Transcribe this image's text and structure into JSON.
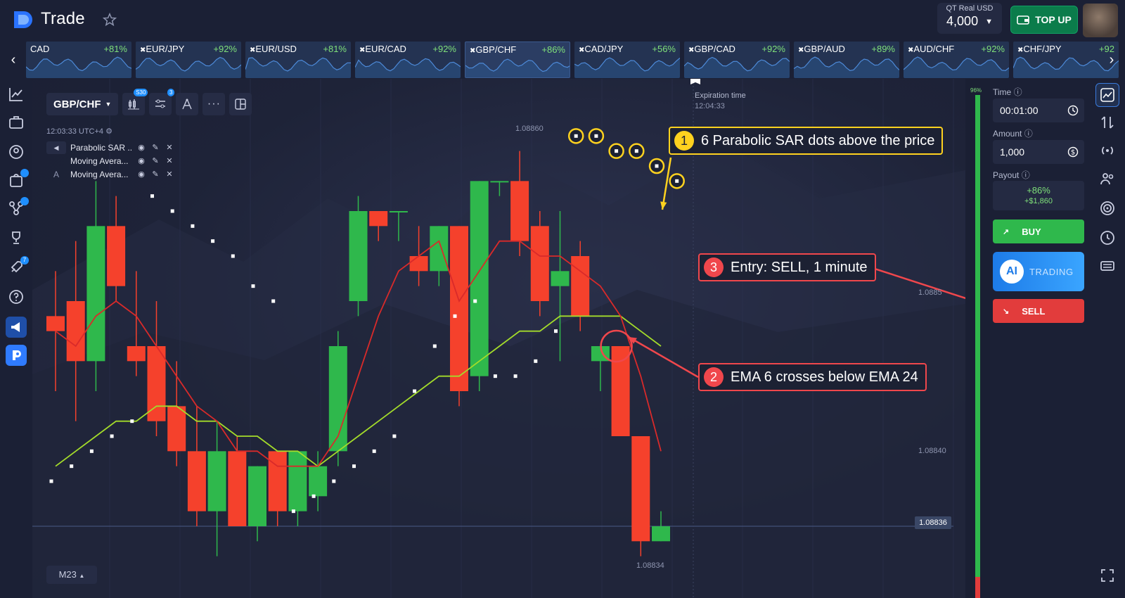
{
  "header": {
    "brand": "Trade",
    "account_label": "QT Real  USD",
    "balance": "4,000",
    "topup_label": "TOP UP"
  },
  "tickers": [
    {
      "name": "CAD",
      "payout": "+81%"
    },
    {
      "name": "EUR/JPY",
      "payout": "+92%"
    },
    {
      "name": "EUR/USD",
      "payout": "+81%"
    },
    {
      "name": "EUR/CAD",
      "payout": "+92%"
    },
    {
      "name": "GBP/CHF",
      "payout": "+86%",
      "active": true
    },
    {
      "name": "CAD/JPY",
      "payout": "+56%"
    },
    {
      "name": "GBP/CAD",
      "payout": "+92%"
    },
    {
      "name": "GBP/AUD",
      "payout": "+89%"
    },
    {
      "name": "AUD/CHF",
      "payout": "+92%"
    },
    {
      "name": "CHF/JPY",
      "payout": "+92"
    }
  ],
  "leftbar": {
    "badges": [
      "7"
    ]
  },
  "chart": {
    "pair": "GBP/CHF",
    "tool_badges": {
      "s30": "S30",
      "indicators": "3"
    },
    "timestamp": "12:03:33 UTC+4",
    "indicators": [
      {
        "name": "Parabolic SAR ..."
      },
      {
        "name": "Moving Avera..."
      },
      {
        "name": "Moving Avera..."
      }
    ],
    "expiration_label": "Expiration time",
    "expiration_time": "12:04:33",
    "price_high": "1.08860",
    "price_mid": "1.0885",
    "price_lower": "1.08840",
    "current_price": "1.08836",
    "price_low": "1.08834",
    "timeframe": "M23",
    "progress_pct": "96%",
    "progress_fraction": 0.96
  },
  "callouts": {
    "c1": {
      "num": "1",
      "text": "6 Parabolic SAR dots above the price"
    },
    "c2": {
      "num": "2",
      "text": "EMA 6 crosses below EMA 24"
    },
    "c3": {
      "num": "3",
      "text": "Entry: SELL, 1 minute"
    }
  },
  "panel": {
    "time_label": "Time",
    "time_value": "00:01:00",
    "amount_label": "Amount",
    "amount_value": "1,000",
    "payout_label": "Payout",
    "payout_pct": "+86%",
    "payout_amount": "+$1,860",
    "buy_label": "BUY",
    "ai_badge": "AI",
    "ai_label": "TRADING",
    "sell_label": "SELL"
  },
  "colors": {
    "bull": "#2fb84c",
    "bear": "#f5412c",
    "ema_fast": "#d92a2a",
    "ema_slow": "#a4dc2a",
    "accent": "#ffd21f",
    "callout_red": "#f0474c"
  },
  "chart_data": {
    "type": "candlestick",
    "candles": [
      {
        "o": 1.0885,
        "h": 1.08853,
        "l": 1.08845,
        "c": 1.08849
      },
      {
        "o": 1.08851,
        "h": 1.08855,
        "l": 1.08843,
        "c": 1.08847
      },
      {
        "o": 1.08847,
        "h": 1.08859,
        "l": 1.08845,
        "c": 1.08856
      },
      {
        "o": 1.08856,
        "h": 1.08858,
        "l": 1.08851,
        "c": 1.08852
      },
      {
        "o": 1.08848,
        "h": 1.08853,
        "l": 1.08846,
        "c": 1.08847
      },
      {
        "o": 1.08848,
        "h": 1.08851,
        "l": 1.08842,
        "c": 1.08843
      },
      {
        "o": 1.08844,
        "h": 1.08847,
        "l": 1.0884,
        "c": 1.08841
      },
      {
        "o": 1.08841,
        "h": 1.08844,
        "l": 1.08836,
        "c": 1.08837
      },
      {
        "o": 1.08837,
        "h": 1.08843,
        "l": 1.08834,
        "c": 1.08841
      },
      {
        "o": 1.08841,
        "h": 1.08842,
        "l": 1.08836,
        "c": 1.08836
      },
      {
        "o": 1.08836,
        "h": 1.0884,
        "l": 1.08835,
        "c": 1.0884
      },
      {
        "o": 1.08841,
        "h": 1.0884,
        "l": 1.08836,
        "c": 1.08837
      },
      {
        "o": 1.08837,
        "h": 1.08841,
        "l": 1.08836,
        "c": 1.08841
      },
      {
        "o": 1.08838,
        "h": 1.08841,
        "l": 1.08837,
        "c": 1.0884
      },
      {
        "o": 1.08841,
        "h": 1.08849,
        "l": 1.0884,
        "c": 1.08848
      },
      {
        "o": 1.08851,
        "h": 1.08858,
        "l": 1.0885,
        "c": 1.08857
      },
      {
        "o": 1.08857,
        "h": 1.08857,
        "l": 1.08855,
        "c": 1.08856
      },
      {
        "o": 1.08857,
        "h": 1.08857,
        "l": 1.08855,
        "c": 1.08857
      },
      {
        "o": 1.08854,
        "h": 1.08856,
        "l": 1.08852,
        "c": 1.08853
      },
      {
        "o": 1.08853,
        "h": 1.08856,
        "l": 1.08852,
        "c": 1.08856
      },
      {
        "o": 1.08856,
        "h": 1.08856,
        "l": 1.08844,
        "c": 1.08845
      },
      {
        "o": 1.08846,
        "h": 1.08859,
        "l": 1.08845,
        "c": 1.08859
      },
      {
        "o": 1.08859,
        "h": 1.08859,
        "l": 1.08858,
        "c": 1.08859
      },
      {
        "o": 1.08859,
        "h": 1.08861,
        "l": 1.08854,
        "c": 1.08855
      },
      {
        "o": 1.08856,
        "h": 1.08857,
        "l": 1.0885,
        "c": 1.08851
      },
      {
        "o": 1.08852,
        "h": 1.08857,
        "l": 1.08847,
        "c": 1.08853
      },
      {
        "o": 1.08854,
        "h": 1.08855,
        "l": 1.08849,
        "c": 1.0885
      },
      {
        "o": 1.08847,
        "h": 1.08848,
        "l": 1.08845,
        "c": 1.08848
      },
      {
        "o": 1.08848,
        "h": 1.08848,
        "l": 1.08842,
        "c": 1.08842
      },
      {
        "o": 1.08842,
        "h": 1.08842,
        "l": 1.08834,
        "c": 1.08835
      },
      {
        "o": 1.08835,
        "h": 1.08837,
        "l": 1.08835,
        "c": 1.08836
      }
    ],
    "sar": [
      1.08839,
      1.0884,
      1.08841,
      1.08842,
      1.08843,
      1.08858,
      1.08857,
      1.08856,
      1.08855,
      1.08854,
      1.08852,
      1.08851,
      1.08837,
      1.08838,
      1.08839,
      1.0884,
      1.08841,
      1.08842,
      1.08845,
      1.08848,
      1.0885,
      1.08851,
      1.08846,
      1.08846,
      1.08847,
      1.08849,
      1.08862,
      1.08862,
      1.08861,
      1.08861,
      1.0886,
      1.08859
    ],
    "ema_fast": [
      1.08849,
      1.08848,
      1.0885,
      1.08851,
      1.0885,
      1.08848,
      1.08846,
      1.08844,
      1.08843,
      1.08841,
      1.08841,
      1.0884,
      1.0884,
      1.0884,
      1.08842,
      1.08846,
      1.0885,
      1.08853,
      1.08854,
      1.08855,
      1.08851,
      1.08853,
      1.08855,
      1.08855,
      1.08854,
      1.08854,
      1.08853,
      1.08852,
      1.0885,
      1.08846,
      1.08841
    ],
    "ema_slow": [
      1.0884,
      1.08841,
      1.08842,
      1.08843,
      1.08843,
      1.08844,
      1.08844,
      1.08843,
      1.08843,
      1.08842,
      1.08842,
      1.08841,
      1.08841,
      1.0884,
      1.08841,
      1.08842,
      1.08843,
      1.08844,
      1.08845,
      1.08846,
      1.08846,
      1.08847,
      1.08848,
      1.08849,
      1.08849,
      1.0885,
      1.0885,
      1.0885,
      1.0885,
      1.08849,
      1.08848
    ],
    "ylim": [
      1.08833,
      1.08863
    ],
    "current": 1.08836
  }
}
